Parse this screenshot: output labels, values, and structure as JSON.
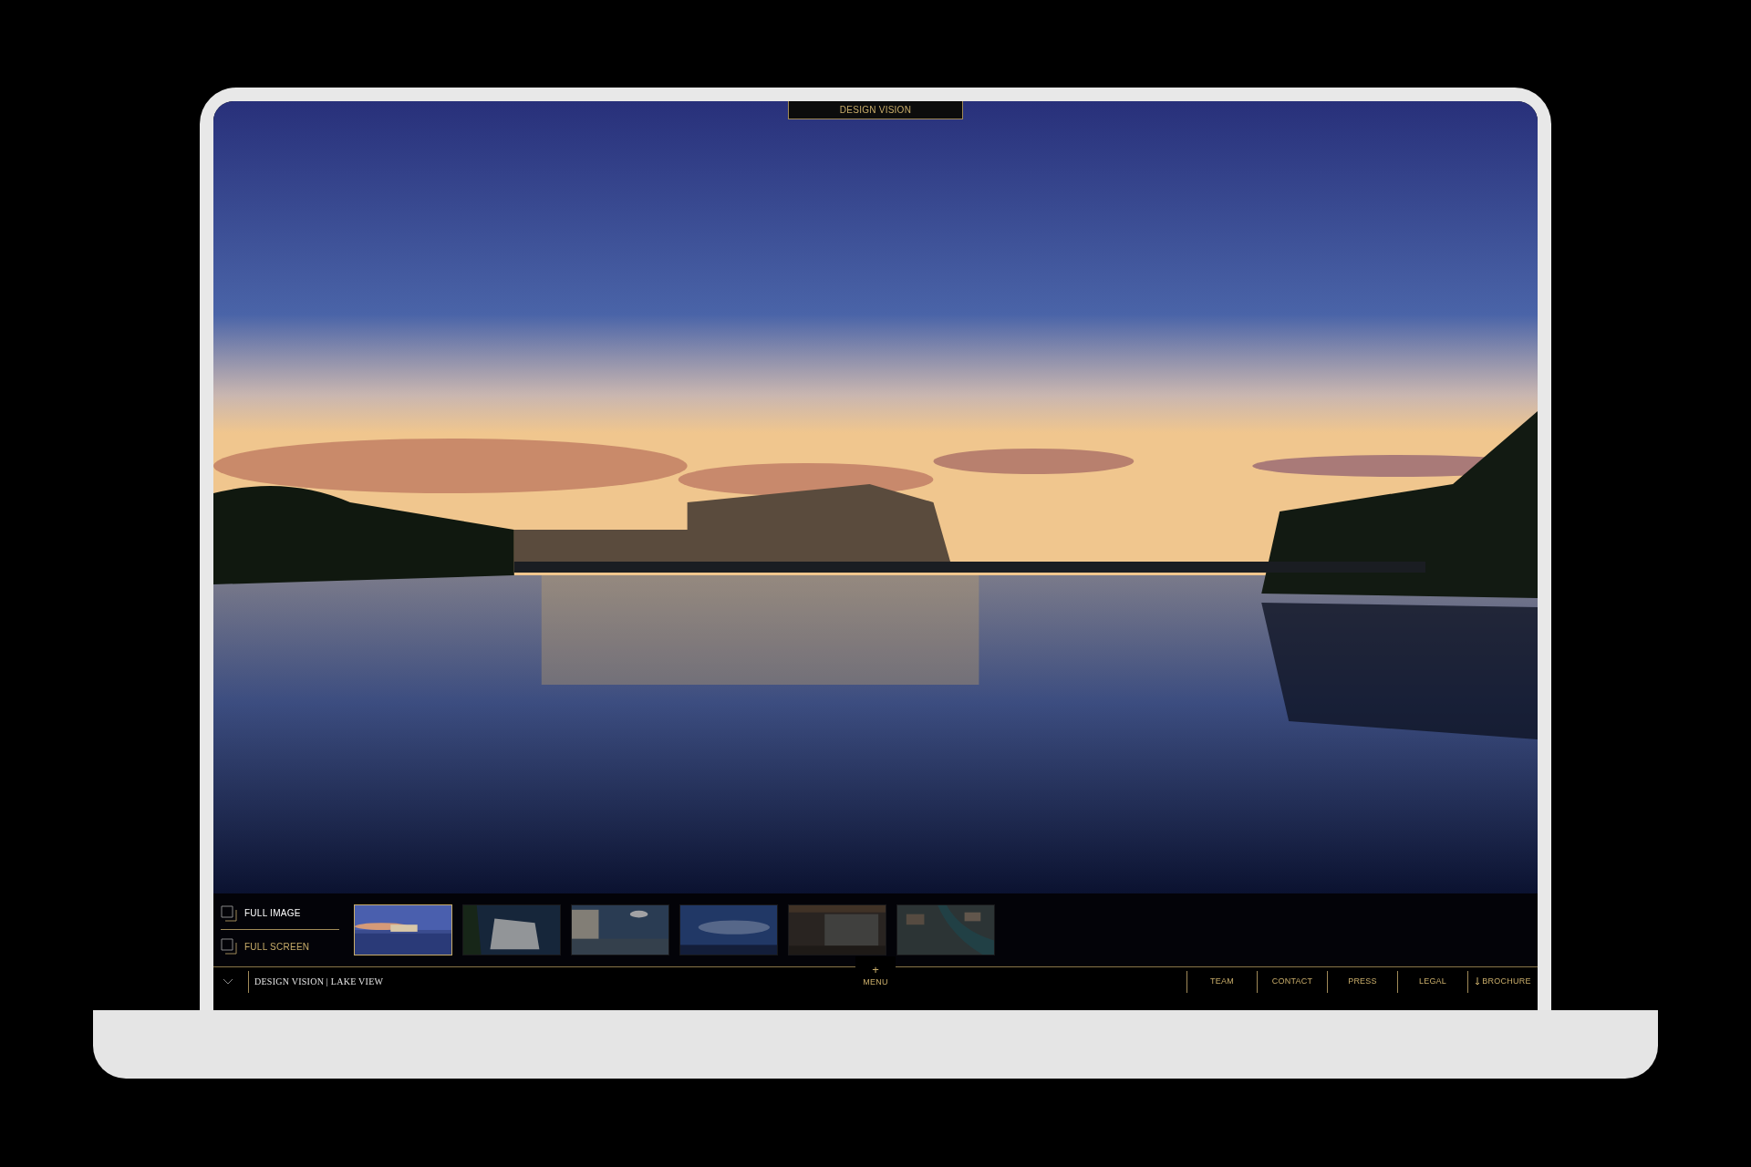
{
  "top_tab": {
    "label": "DESIGN VISION"
  },
  "view_modes": [
    {
      "label": "FULL IMAGE",
      "selected": true
    },
    {
      "label": "FULL SCREEN",
      "selected": false
    }
  ],
  "thumbnails": [
    {
      "kind": "lake",
      "selected": true
    },
    {
      "kind": "building",
      "selected": false
    },
    {
      "kind": "waterfront",
      "selected": false
    },
    {
      "kind": "sky",
      "selected": false
    },
    {
      "kind": "interior",
      "selected": false
    },
    {
      "kind": "aerial",
      "selected": false
    }
  ],
  "breadcrumb": "DESIGN VISION | LAKE VIEW",
  "menu": {
    "icon": "+",
    "label": "MENU"
  },
  "footer_links": [
    {
      "label": "TEAM",
      "kind": "link"
    },
    {
      "label": "CONTACT",
      "kind": "link"
    },
    {
      "label": "PRESS",
      "kind": "link"
    },
    {
      "label": "LEGAL",
      "kind": "link"
    },
    {
      "label": "BROCHURE",
      "kind": "download"
    }
  ]
}
